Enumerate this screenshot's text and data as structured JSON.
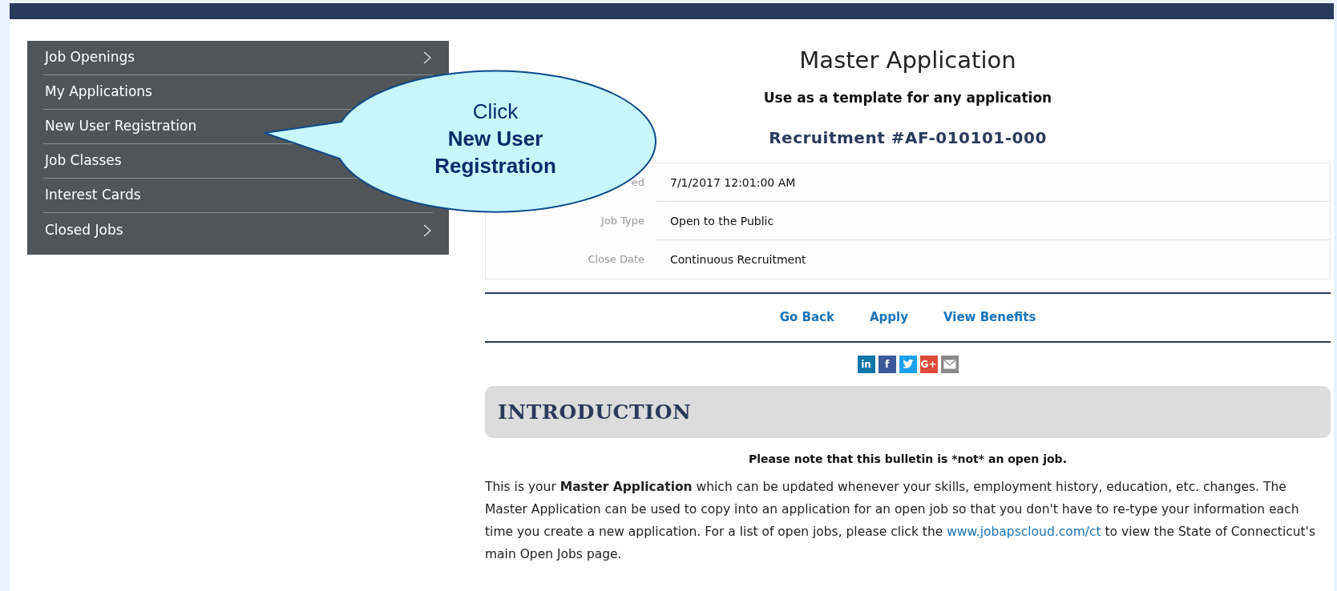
{
  "sidebar": {
    "items": [
      {
        "label": "Job Openings",
        "arrow": true
      },
      {
        "label": "My Applications"
      },
      {
        "label": "New User Registration"
      },
      {
        "label": "Job Classes"
      },
      {
        "label": "Interest Cards"
      },
      {
        "label": "Closed Jobs",
        "arrow": true
      }
    ]
  },
  "callout": {
    "line1": "Click",
    "line2": "New User",
    "line3": "Registration"
  },
  "job": {
    "title": "Master Application",
    "subtitle": "Use as a template for any application",
    "recruitment": "Recruitment #AF-010101-000",
    "details": [
      {
        "label": "ed",
        "value": "7/1/2017 12:01:00 AM"
      },
      {
        "label": "Job Type",
        "value": "Open to the Public"
      },
      {
        "label": "Close Date",
        "value": "Continuous Recruitment"
      }
    ],
    "links": [
      "Go Back",
      "Apply",
      "View Benefits"
    ],
    "share_icons": [
      {
        "kind": "letter",
        "glyph": "in",
        "color": "#0e76a8"
      },
      {
        "kind": "letter",
        "glyph": "f",
        "color": "#3b5998"
      },
      {
        "kind": "bird",
        "color": "#1da1f2"
      },
      {
        "kind": "letter",
        "glyph": "G+",
        "color": "#dd4b39"
      },
      {
        "kind": "envelope",
        "color": "#8a8a8a"
      }
    ]
  },
  "introduction": {
    "heading": "INTRODUCTION",
    "note": "Please note that this bulletin is *not* an open job.",
    "paragraph_start": "This is your **Master Application** which can be updated whenever your skills, employment history, education, etc. changes.  The Master Application can be used to copy into an application for an open job so that you don't have to re-type your information each time you create a new application. For a list of open jobs, please click the",
    "link": "www.jobapscloud.com/ct",
    "paragraph_end": "to view the  State of Connecticut's main Open Jobs page."
  }
}
